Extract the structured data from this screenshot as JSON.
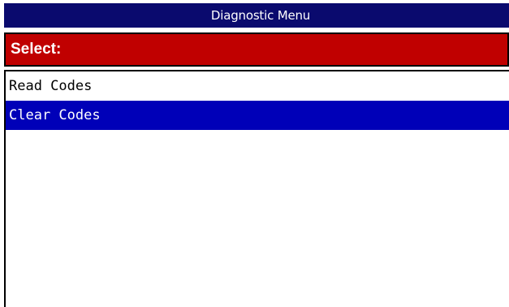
{
  "window": {
    "title": "Diagnostic Menu"
  },
  "prompt": {
    "label": "Select:"
  },
  "menu": {
    "items": [
      {
        "label": "Read Codes",
        "selected": false
      },
      {
        "label": "Clear Codes",
        "selected": true
      }
    ]
  },
  "colors": {
    "title_bar": "#0a0a6e",
    "prompt_bar": "#c00000",
    "selection": "#0000b8"
  }
}
